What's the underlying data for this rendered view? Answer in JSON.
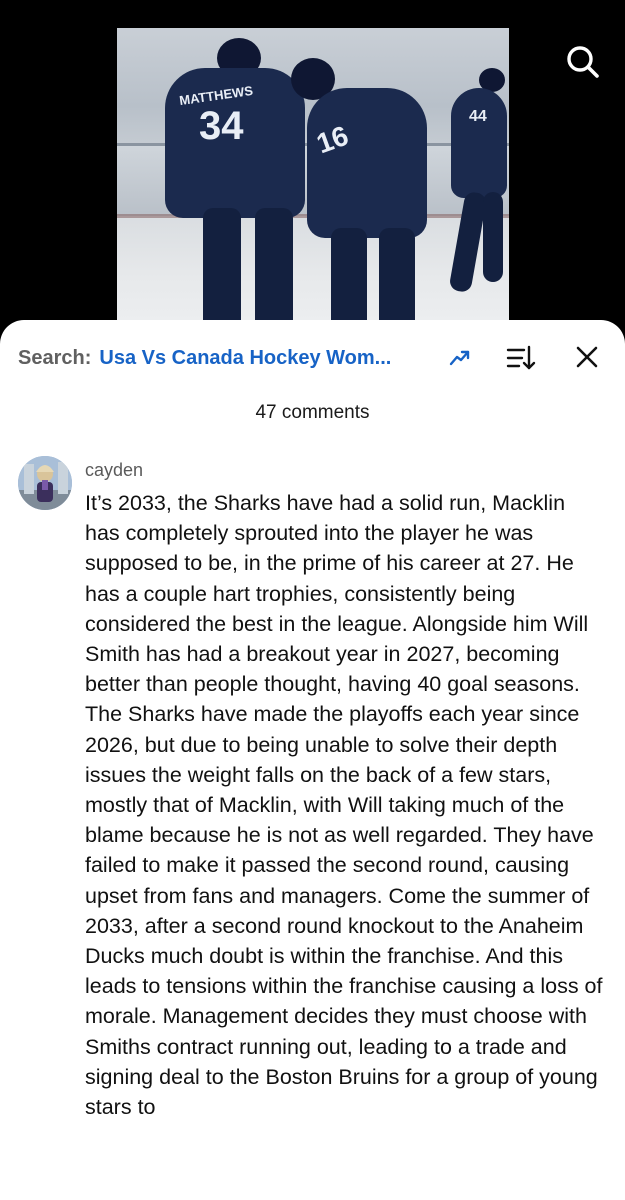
{
  "video": {
    "jersey_numbers": [
      "34",
      "16",
      "44"
    ],
    "jersey_name": "MATTHEWS"
  },
  "header": {
    "search_label": "Search:",
    "search_query": "Usa Vs Canada Hockey Wom..."
  },
  "icons": {
    "search": "search-icon",
    "trending": "trending-up-icon",
    "sort": "sort-icon",
    "close": "close-icon"
  },
  "comments": {
    "count_label": "47 comments",
    "items": [
      {
        "author": "cayden",
        "text": "It’s 2033, the Sharks have had a solid run, Macklin has completely sprouted into the player he was supposed to be, in the prime of his career at 27. He has a couple hart trophies, consistently being considered the best in the league. Alongside him Will Smith has had a breakout year in 2027, becoming better than people thought, having 40 goal seasons. The Sharks have made the playoffs each year since 2026, but due to being unable to solve their depth issues the weight falls on the back of a few stars, mostly that of Macklin, with Will taking much of the blame because he is not as well regarded. They have failed to make it passed the second round, causing upset from fans and managers. Come the summer of 2033, after a second round knockout to the Anaheim Ducks much doubt is within the franchise. And this leads to tensions within the franchise causing a loss of morale. Management decides they must choose with Smiths contract running out, leading to a trade and signing deal to the Boston Bruins for a group of young stars to"
      }
    ]
  },
  "colors": {
    "accent": "#1763c6",
    "sheet_bg": "#ffffff",
    "video_bg": "#000000"
  }
}
